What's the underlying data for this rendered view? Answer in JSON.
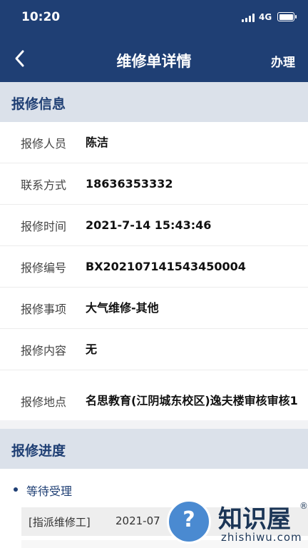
{
  "status_bar": {
    "time": "10:20",
    "network": "4G"
  },
  "nav": {
    "title": "维修单详情",
    "action": "办理"
  },
  "info_section": {
    "title": "报修信息",
    "rows": [
      {
        "label": "报修人员",
        "value": "陈洁"
      },
      {
        "label": "联系方式",
        "value": "18636353332"
      },
      {
        "label": "报修时间",
        "value": "2021-7-14 15:43:46"
      },
      {
        "label": "报修编号",
        "value": "BX202107141543450004"
      },
      {
        "label": "报修事项",
        "value": "大气维修-其他"
      },
      {
        "label": "报修内容",
        "value": "无"
      },
      {
        "label": "报修地点",
        "value": "名思教育(江阴城东校区)逸夫楼审核审核1"
      }
    ]
  },
  "progress_section": {
    "title": "报修进度",
    "steps": [
      {
        "label": "等待受理",
        "log_tag": "[指派维修工]",
        "log_time": "2021-07"
      }
    ]
  },
  "watermark": {
    "text": "知识屋",
    "sub": "zhishiwu.com",
    "reg": "®",
    "badge": "?"
  },
  "colors": {
    "primary": "#1f3f74",
    "section_bg": "#dbe1ea"
  }
}
